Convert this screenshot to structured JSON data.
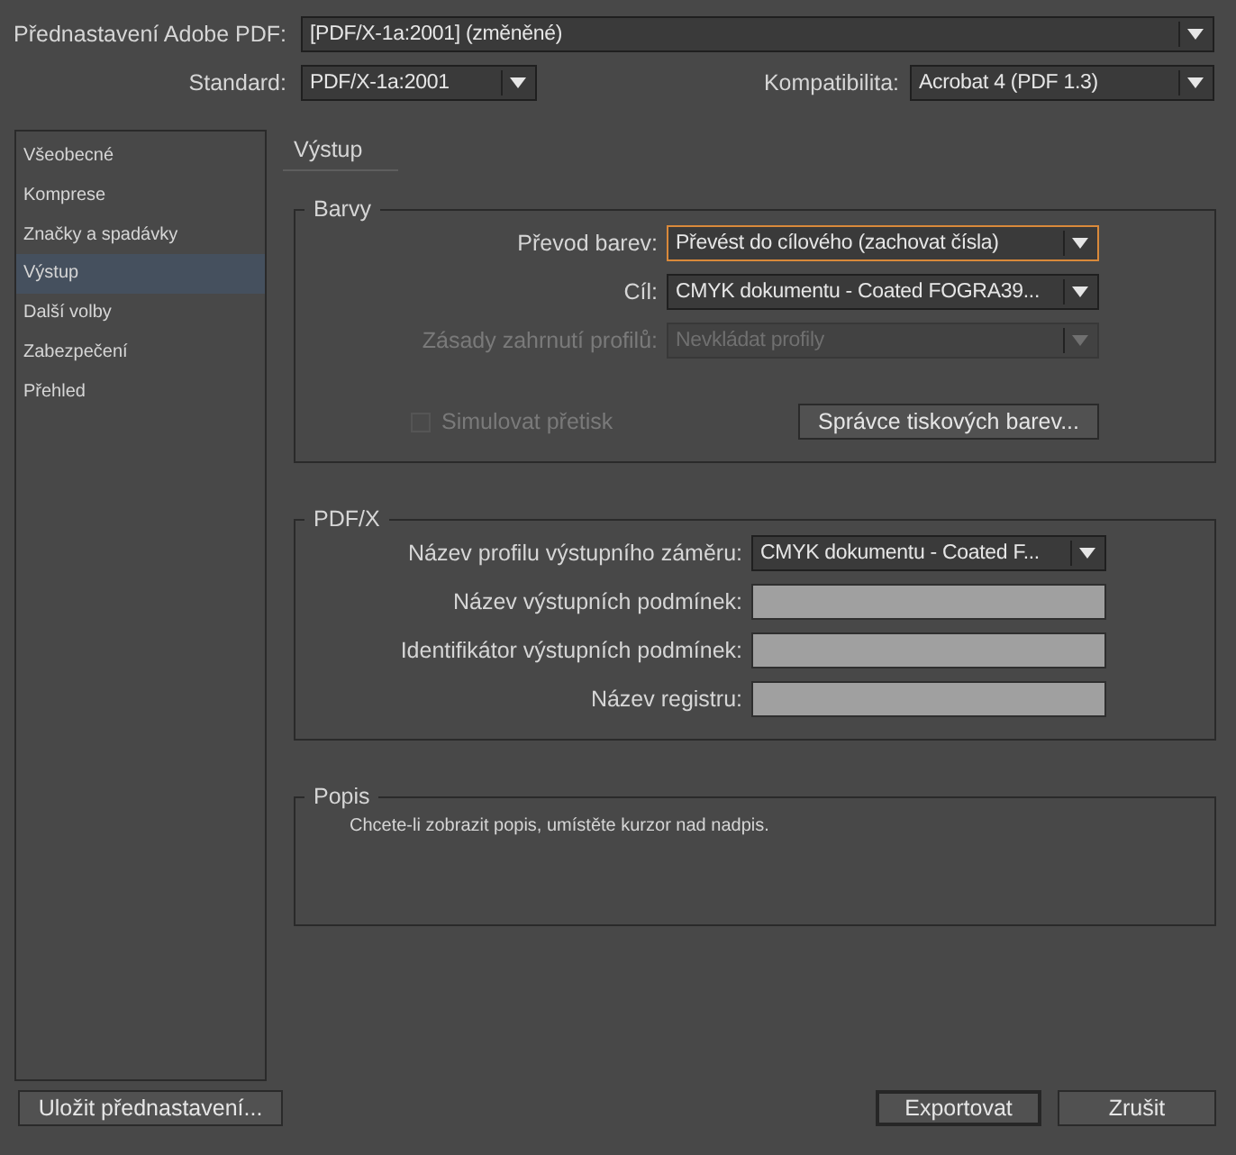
{
  "header": {
    "preset": {
      "label": "Přednastavení Adobe PDF:",
      "value": "[PDF/X-1a:2001] (změněné)"
    },
    "standard": {
      "label": "Standard:",
      "value": "PDF/X-1a:2001"
    },
    "compatibility": {
      "label": "Kompatibilita:",
      "value": "Acrobat 4 (PDF 1.3)"
    }
  },
  "sidebar": {
    "items": [
      {
        "label": "Všeobecné",
        "selected": false
      },
      {
        "label": "Komprese",
        "selected": false
      },
      {
        "label": "Značky a spadávky",
        "selected": false
      },
      {
        "label": "Výstup",
        "selected": true
      },
      {
        "label": "Další volby",
        "selected": false
      },
      {
        "label": "Zabezpečení",
        "selected": false
      },
      {
        "label": "Přehled",
        "selected": false
      }
    ]
  },
  "section_title": "Výstup",
  "groups": [
    {
      "title": "Barvy",
      "rows": [
        {
          "kind": "select",
          "label": "Převod barev:",
          "value": "Převést do cílového (zachovat čísla)",
          "disabled": false,
          "focused": true
        },
        {
          "kind": "select",
          "label": "Cíl:",
          "value": "CMYK dokumentu - Coated FOGRA39...",
          "disabled": false,
          "focused": false
        },
        {
          "kind": "select",
          "label": "Zásady zahrnutí profilů:",
          "value": "Nevkládat profily",
          "disabled": true,
          "focused": false
        },
        {
          "kind": "checkbox_button",
          "label": "Simulovat přetisk",
          "checked": false,
          "disabled": true,
          "button": "Správce tiskových barev..."
        }
      ]
    },
    {
      "title": "PDF/X",
      "rows": [
        {
          "kind": "select",
          "label": "Název profilu výstupního záměru:",
          "value": "CMYK dokumentu - Coated F...",
          "disabled": false,
          "focused": false
        },
        {
          "kind": "field",
          "label": "Název výstupních podmínek:",
          "disabled": true
        },
        {
          "kind": "field",
          "label": "Identifikátor výstupních podmínek:",
          "disabled": true
        },
        {
          "kind": "field",
          "label": "Název registru:",
          "disabled": true
        }
      ]
    }
  ],
  "description": {
    "title": "Popis",
    "text": "Chcete-li zobrazit popis, umístěte kurzor nad nadpis."
  },
  "buttons": {
    "save": "Uložit přednastavení...",
    "export": "Exportovat",
    "cancel": "Zrušit"
  }
}
